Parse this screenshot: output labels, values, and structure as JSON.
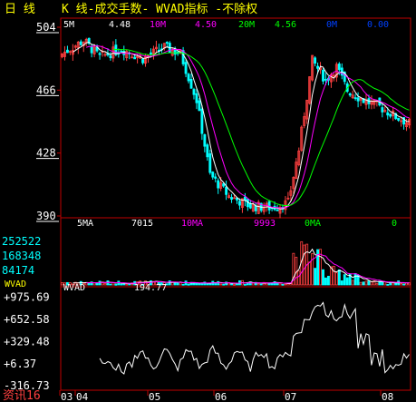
{
  "title": {
    "period_label": "日  线",
    "chart_label": "K  线-成交手数-  WVAD指标  -不除权"
  },
  "colors": {
    "background": "#000000",
    "frame": "#c00000",
    "up": "#ff4040",
    "down": "#00ffff",
    "ma5": "#ffffff",
    "ma10": "#ff00ff",
    "ma20": "#00ff00",
    "ma30": "#ffff00",
    "axis_text": "#ffffff",
    "title_text": "#ffff00",
    "source_text": "#ff4040",
    "vol_axis_text": "#00ffff"
  },
  "price_panel": {
    "ma_legend": [
      {
        "label": "5M",
        "value": "4.48",
        "color": "#ffffff"
      },
      {
        "label": "10M",
        "value": "4.50",
        "color": "#ff00ff"
      },
      {
        "label": "20M",
        "value": "4.56",
        "color": "#00ff00"
      },
      {
        "label": "0M",
        "value": "0.00",
        "color": "#0040ff"
      }
    ],
    "y_ticks": [
      "504",
      "466",
      "428",
      "390"
    ],
    "y_range": [
      3.9,
      5.04
    ]
  },
  "volume_panel": {
    "legend": [
      {
        "label": "5MA",
        "value": "7015",
        "color": "#ffffff"
      },
      {
        "label": "10MA",
        "value": "9993",
        "color": "#ff00ff"
      },
      {
        "label": "0MA",
        "value": "0",
        "color": "#00ff00"
      }
    ],
    "y_ticks": [
      "252522",
      "168348",
      "84174"
    ],
    "y_range": [
      0,
      336696
    ]
  },
  "wvad_panel": {
    "label": "WVAD",
    "value": "194.77",
    "y_ticks": [
      "+975.69",
      "+652.58",
      "+329.48",
      "+6.37",
      "-316.73"
    ],
    "y_range": [
      -380,
      1050
    ]
  },
  "x_axis": {
    "labels": [
      "03",
      "04",
      "05",
      "06",
      "07",
      "08"
    ]
  },
  "source_label": "资讯16",
  "chart_data": {
    "type": "candlestick",
    "note": "approximate daily OHLC read from image",
    "candles": [],
    "months": [
      "03",
      "04",
      "05",
      "06",
      "07",
      "08"
    ]
  }
}
